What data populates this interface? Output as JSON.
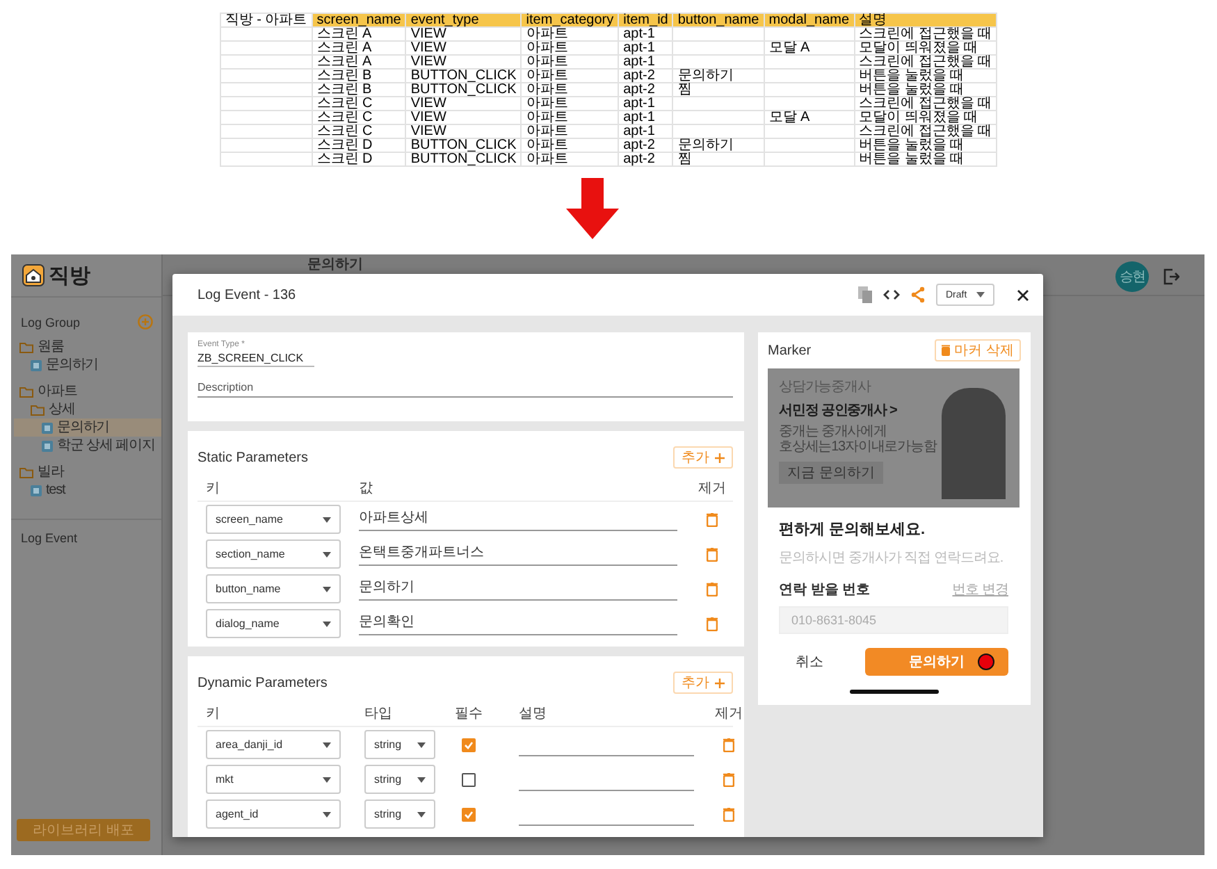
{
  "spreadsheet": {
    "columns": [
      "직방 - 아파트",
      "screen_name",
      "event_type",
      "item_category",
      "item_id",
      "button_name",
      "modal_name",
      "설명"
    ],
    "rows": [
      [
        null,
        "스크린 A",
        "VIEW",
        "아파트",
        "apt-1",
        null,
        null,
        "스크린에 접근했을 때"
      ],
      [
        null,
        "스크린 A",
        "VIEW",
        "아파트",
        "apt-1",
        null,
        "모달 A",
        "모달이 띄워졌을 때"
      ],
      [
        null,
        "스크린 A",
        "VIEW",
        "아파트",
        "apt-1",
        null,
        null,
        "스크린에 접근했을 때"
      ],
      [
        null,
        "스크린 B",
        "BUTTON_CLICK",
        "아파트",
        "apt-2",
        "문의하기",
        null,
        "버튼을 눌렀을 때"
      ],
      [
        null,
        "스크린 B",
        "BUTTON_CLICK",
        "아파트",
        "apt-2",
        "찜",
        null,
        "버튼을 눌렀을 때"
      ],
      [
        null,
        "스크린 C",
        "VIEW",
        "아파트",
        "apt-1",
        null,
        null,
        "스크린에 접근했을 때"
      ],
      [
        null,
        "스크린 C",
        "VIEW",
        "아파트",
        "apt-1",
        null,
        "모달 A",
        "모달이 띄워졌을 때"
      ],
      [
        null,
        "스크린 C",
        "VIEW",
        "아파트",
        "apt-1",
        null,
        null,
        "스크린에 접근했을 때"
      ],
      [
        null,
        "스크린 D",
        "BUTTON_CLICK",
        "아파트",
        "apt-2",
        "문의하기",
        null,
        "버튼을 눌렀을 때"
      ],
      [
        null,
        "스크린 D",
        "BUTTON_CLICK",
        "아파트",
        "apt-2",
        "찜",
        null,
        "버튼을 눌렀을 때"
      ]
    ]
  },
  "app": {
    "logo": "직방",
    "sidebar": {
      "title": "Log Group",
      "tree": [
        {
          "kind": "folder",
          "label": "원룸",
          "selected": false,
          "children": [
            {
              "kind": "event",
              "label": "문의하기",
              "selected": false
            }
          ]
        },
        {
          "kind": "folder",
          "label": "아파트",
          "selected": false,
          "children": [
            {
              "kind": "folder",
              "label": "상세",
              "selected": false,
              "children": [
                {
                  "kind": "event",
                  "label": "문의하기",
                  "selected": true
                },
                {
                  "kind": "event",
                  "label": "학군 상세 페이지",
                  "selected": false
                }
              ]
            }
          ]
        },
        {
          "kind": "folder",
          "label": "빌라",
          "selected": false,
          "children": [
            {
              "kind": "event",
              "label": "test",
              "selected": false
            }
          ]
        }
      ],
      "log_event": "Log Event",
      "deploy_button": "라이브러리 배포"
    },
    "breadcrumb": "문의하기",
    "user": {
      "initials": "승현"
    }
  },
  "modal": {
    "title": "Log Event - 136",
    "status": "Draft",
    "event_type": {
      "label": "Event Type *",
      "value": "ZB_SCREEN_CLICK"
    },
    "description": {
      "placeholder": "Description"
    },
    "static_parameters": {
      "title": "Static Parameters",
      "add_button": "추가",
      "columns": [
        "키",
        "값",
        "제거"
      ],
      "rows": [
        {
          "key": "screen_name",
          "value": "아파트상세"
        },
        {
          "key": "section_name",
          "value": "온택트중개파트너스"
        },
        {
          "key": "button_name",
          "value": "문의하기"
        },
        {
          "key": "dialog_name",
          "value": "문의확인"
        }
      ]
    },
    "dynamic_parameters": {
      "title": "Dynamic Parameters",
      "add_button": "추가",
      "columns": [
        "키",
        "타입",
        "필수",
        "설명",
        "제거"
      ],
      "rows": [
        {
          "key": "area_danji_id",
          "type": "string",
          "required": true
        },
        {
          "key": "mkt",
          "type": "string",
          "required": false
        },
        {
          "key": "agent_id",
          "type": "string",
          "required": true
        }
      ]
    },
    "marker": {
      "title": "Marker",
      "delete_button": "마커 삭제",
      "preview": {
        "banner_caption": "상담가능중개사",
        "agent_link": "서민정 공인중개사 >",
        "banner_lines": [
          "중개는 중개사에게",
          "호상세는13자이내로가능함"
        ],
        "banner_button": "지금 문의하기",
        "heading": "편하게 문의해보세요.",
        "subtext": "문의하시면 중개사가 직접 연락드려요.",
        "phone_label": "연락 받을 번호",
        "change_link": "번호 변경",
        "phone_placeholder": "010-8631-8045",
        "cancel_button": "취소",
        "submit_button": "문의하기"
      }
    }
  }
}
